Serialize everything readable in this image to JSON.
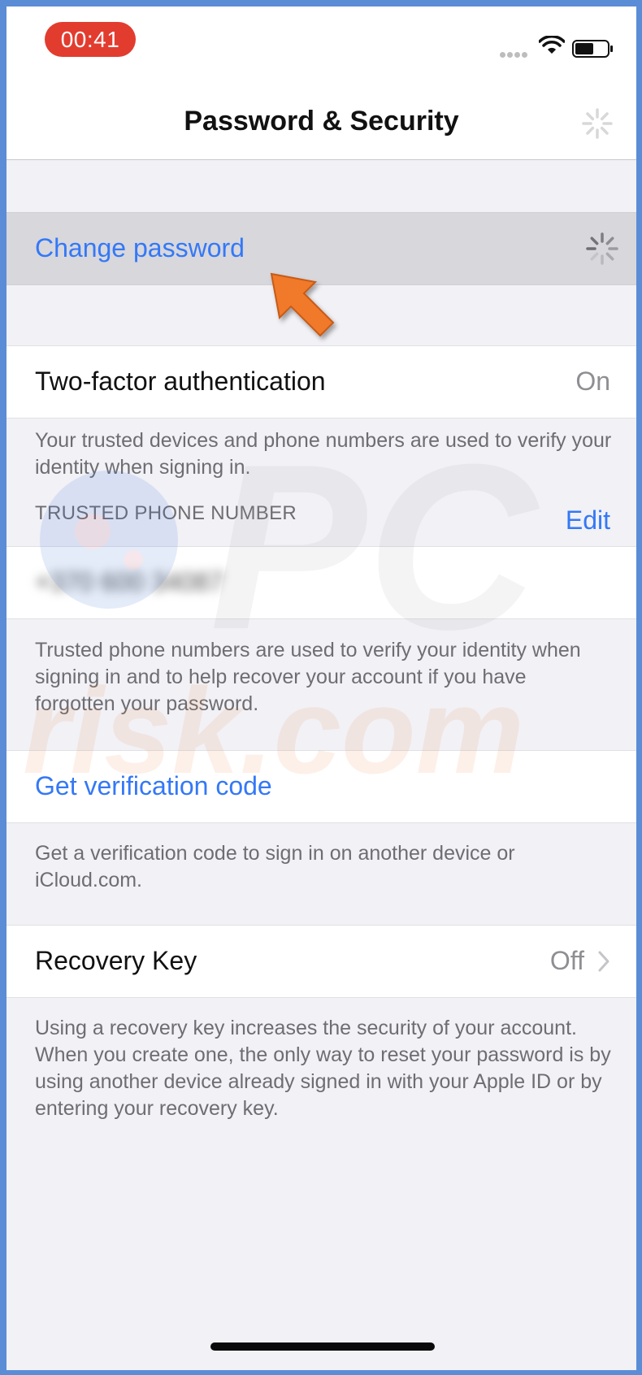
{
  "status": {
    "time": "00:41"
  },
  "nav": {
    "title": "Password & Security"
  },
  "change_password": {
    "label": "Change password"
  },
  "two_factor": {
    "label": "Two-factor authentication",
    "value": "On",
    "description": "Your trusted devices and phone numbers are used to verify your identity when signing in."
  },
  "trusted_phone": {
    "header": "TRUSTED PHONE NUMBER",
    "edit_label": "Edit",
    "number": "+370 600 34087",
    "description": "Trusted phone numbers are used to verify your identity when signing in and to help recover your account if you have forgotten your password."
  },
  "verification": {
    "label": "Get verification code",
    "description": "Get a verification code to sign in on another device or iCloud.com."
  },
  "recovery_key": {
    "label": "Recovery Key",
    "value": "Off",
    "description": "Using a recovery key increases the security of your account. When you create one, the only way to reset your password is by using another device already signed in with your Apple ID or by entering your recovery key."
  },
  "watermark": {
    "brand_top": "PC",
    "brand_bottom": "risk.com"
  },
  "colors": {
    "accent": "#3478f6",
    "status_pill": "#e23c2f",
    "arrow": "#f07a2a",
    "frame": "#5b8dd6"
  }
}
